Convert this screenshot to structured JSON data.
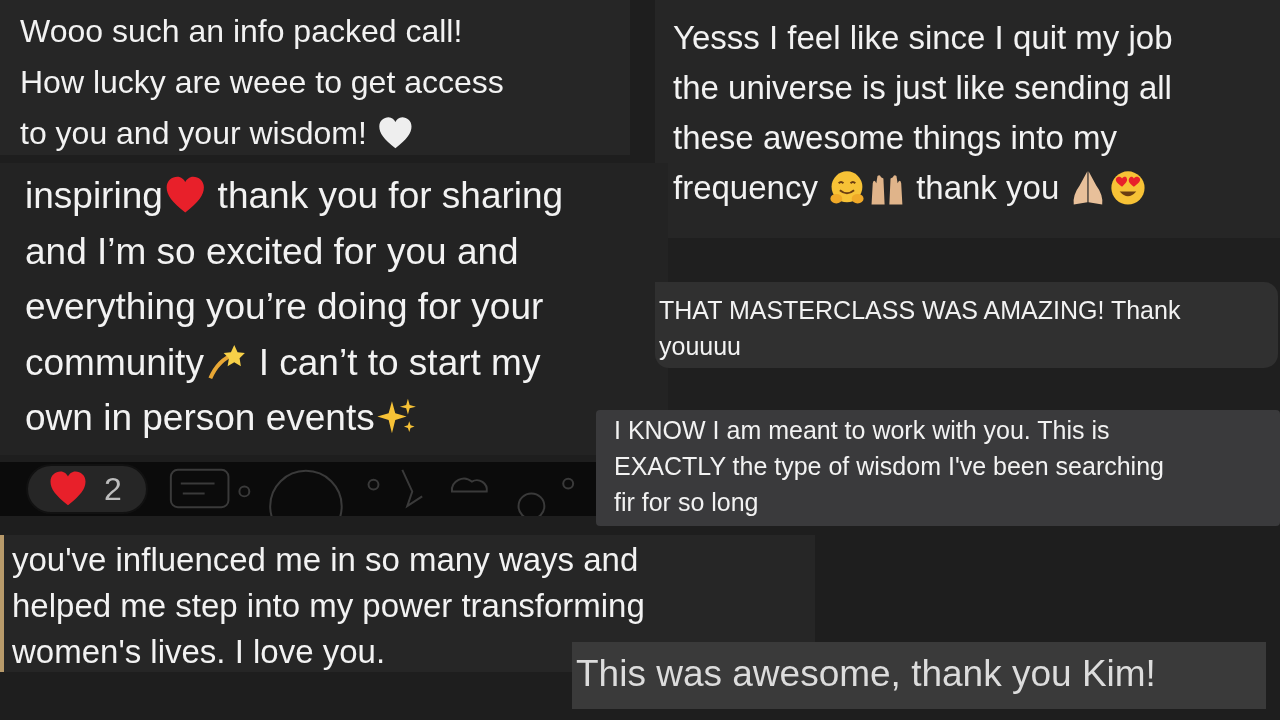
{
  "messages": [
    {
      "lines": [
        [
          {
            "kind": "text",
            "text": "Wooo such an info packed call!"
          }
        ],
        [
          {
            "kind": "text",
            "text": "How lucky are weee to get access"
          }
        ],
        [
          {
            "kind": "text",
            "text": "to you and your wisdom! "
          },
          {
            "kind": "white-heart"
          }
        ]
      ]
    },
    {
      "lines": [
        [
          {
            "kind": "text",
            "text": "Yesss I feel like since I quit my job"
          }
        ],
        [
          {
            "kind": "text",
            "text": "the universe is just like sending all"
          }
        ],
        [
          {
            "kind": "text",
            "text": "these awesome things into my"
          }
        ],
        [
          {
            "kind": "text",
            "text": "frequency "
          },
          {
            "kind": "hug-face"
          },
          {
            "kind": "raised-hands"
          },
          {
            "kind": "text",
            "text": " thank you "
          },
          {
            "kind": "folded-hands"
          },
          {
            "kind": "heart-eyes"
          }
        ]
      ]
    },
    {
      "lines": [
        [
          {
            "kind": "text",
            "text": "inspiring"
          },
          {
            "kind": "red-heart"
          },
          {
            "kind": "text",
            "text": " thank you for sharing"
          }
        ],
        [
          {
            "kind": "text",
            "text": "and I’m so excited for you and"
          }
        ],
        [
          {
            "kind": "text",
            "text": "everything you’re doing for your"
          }
        ],
        [
          {
            "kind": "text",
            "text": "community"
          },
          {
            "kind": "dizzy"
          },
          {
            "kind": "text",
            "text": " I can’t to start my"
          }
        ],
        [
          {
            "kind": "text",
            "text": "own in person events"
          },
          {
            "kind": "sparkles"
          }
        ]
      ],
      "reaction": {
        "count": "2"
      }
    },
    {
      "lines": [
        [
          {
            "kind": "text",
            "text": "THAT MASTERCLASS WAS AMAZING! Thank"
          }
        ],
        [
          {
            "kind": "text",
            "text": "youuuu"
          }
        ]
      ]
    },
    {
      "lines": [
        [
          {
            "kind": "text",
            "text": "I KNOW I am meant to work with you. This is"
          }
        ],
        [
          {
            "kind": "text",
            "text": "EXACTLY the type of wisdom I've been searching"
          }
        ],
        [
          {
            "kind": "text",
            "text": "fir for so long"
          }
        ]
      ]
    },
    {
      "lines": [
        [
          {
            "kind": "text",
            "text": "you've influenced me in so many ways and"
          }
        ],
        [
          {
            "kind": "text",
            "text": "helped me step into my power transforming"
          }
        ],
        [
          {
            "kind": "text",
            "text": "women's lives. I love you."
          }
        ]
      ]
    },
    {
      "lines": [
        [
          {
            "kind": "text",
            "text": "This was awesome, thank you Kim!"
          }
        ]
      ]
    }
  ]
}
